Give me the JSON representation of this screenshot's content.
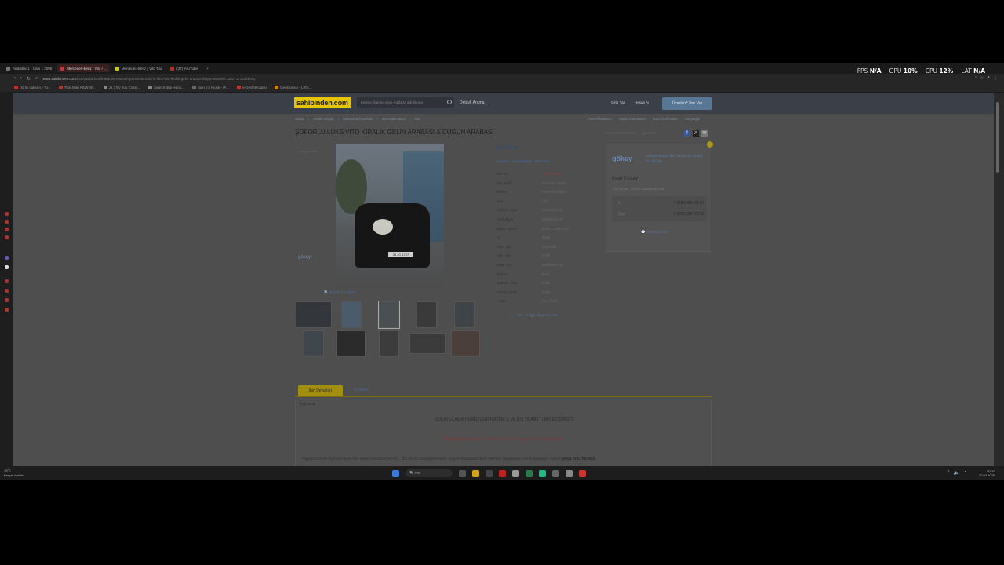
{
  "hud": {
    "fps_label": "FPS",
    "fps": "N/A",
    "gpu_label": "GPU",
    "gpu": "10%",
    "cpu_label": "CPU",
    "cpu": "12%",
    "lat_label": "LAT",
    "lat": "N/A"
  },
  "browser": {
    "tabs": [
      {
        "label": "Araballar 1 - Cars 1 2006",
        "color": "#777"
      },
      {
        "label": "Mercedes-Benz / Vito / ...",
        "color": "#c33"
      },
      {
        "label": "Mercedes-Benz [ Vito Tou",
        "color": "#cc0"
      },
      {
        "label": "(37) YouTube",
        "color": "#c22"
      }
    ],
    "url_host": "www.sahibinden.com",
    "url_path": "/ilan/vasita-kiralik-araclar-minivan-panelvan-soforlu-luks-vito-kiralik-gelin-arabasi-dugun-arabasi-1282717154/detay",
    "bookmarks": [
      "(5) İlk videom - Yo...",
      "That Man NEW W...",
      "Ja 3 By You Custo...",
      "Search drip jeans...",
      "Sign in | Kiosk - Pr...",
      "e-Devlet Kapısı",
      "GeoGuessr - Let's..."
    ]
  },
  "site": {
    "logo": "sahibinden.com",
    "search_placeholder": "Kelime, İlan no veya mağaza adı ile ara",
    "advanced_search": "Detaylı Arama",
    "login": "Giriş Yap",
    "signup": "Hesap Aç",
    "post_ad": "Ücretsiz* İlan Ver"
  },
  "breadcrumbs": [
    "Vasıta",
    "Kiralık Araçlar",
    "Minivan & Panelvan",
    "Mercedes-Benz",
    "Vito"
  ],
  "breadcrumbs_right": [
    "Favori İlanlarım",
    "Favori Aramalarım",
    "Size Özel İlanlar",
    "Karşılaştır"
  ],
  "listing": {
    "title": "ŞOFÖRLÜ LÜKS VİTO KİRALIK GELİN ARABASI & DÜĞÜN ARABASI",
    "add_favorite": "Favorilerime Ekle",
    "print": "Yazdır",
    "photo_watermark": "gökay",
    "photo_hint": "ilanı görüntüle",
    "plate": "34 JC 1767",
    "big_photo": "Büyük Fotoğraf",
    "photo_count": "13/35 Fotoğraf",
    "price": "100 TL",
    "location": [
      "İstanbul",
      "Sancaktepe",
      "Sefa Mah."
    ],
    "specs": [
      {
        "k": "İlan No",
        "v": "1282717154",
        "red": true
      },
      {
        "k": "İlan Tarihi",
        "v": "09 Nisan 2026"
      },
      {
        "k": "Marka",
        "v": "Mercedes-Benz"
      },
      {
        "k": "Seri",
        "v": "Vito"
      },
      {
        "k": "Haftalık Fiyat",
        "v": "Belirtilmemiş"
      },
      {
        "k": "Aylık Fiyat",
        "v": "Belirtilmemiş"
      },
      {
        "k": "Motor Hacmi",
        "v": "2001 - 2500 cm3"
      },
      {
        "k": "Yıl",
        "v": "2025"
      },
      {
        "k": "Vites Tipi",
        "v": "Otomatik"
      },
      {
        "k": "Yakıt Tipi",
        "v": "Dizel"
      },
      {
        "k": "Kasa Tipi",
        "v": "Belirtilmemiş"
      },
      {
        "k": "Şoförlü",
        "v": "Evet"
      },
      {
        "k": "Depozit Türü",
        "v": "Nakit"
      },
      {
        "k": "Ödeme Şekli",
        "v": "Nakit"
      },
      {
        "k": "Kasko",
        "v": "Full Kasko"
      }
    ],
    "complaint": "İlan ile İlgili Şikayetim Var"
  },
  "seller": {
    "logo_text": "gökay",
    "company": "Gökay Ulaşım Hiz.Turizm İç ve Dış Tic.Ltd.Şti",
    "name": "Kadir Gökay",
    "meta": "Tüm İlanları · Favori Satıcılarıma ekle",
    "phone_work_label": "İş",
    "phone_work": "0 (216) 484 05 33",
    "phone_mobile_label": "Cep",
    "phone_mobile": "0 (532) 296 78 33",
    "message": "Mesaj gönder"
  },
  "detail_tabs": {
    "details": "İlan Detayları",
    "location": "Konumu"
  },
  "description": {
    "header": "Açıklama",
    "company_line": "GÖKAY ULAŞIM HİZMETLERİ TURİZM İÇ VE DIŞ TİCARET LİMİTED ŞİRKETİ",
    "tagline": "Düğün Gününüz İçin Konforlu, Lüks ve Profesyonel Ulaşım Hizmetleri",
    "body": "Hayatınızın en özel gününde her detay kusursuz olmalı... Biz de bu özel gününüzde ulaşım konusunu sizin yerinize düşünüyor, her kapasiteye uygun",
    "body_bold": "geniş araç filomuz"
  },
  "taskbar": {
    "weather_temp": "19°C",
    "weather_text": "Parçalı bulutlu",
    "search": "Ara",
    "time": "00:02",
    "date": "20.04.2026"
  }
}
